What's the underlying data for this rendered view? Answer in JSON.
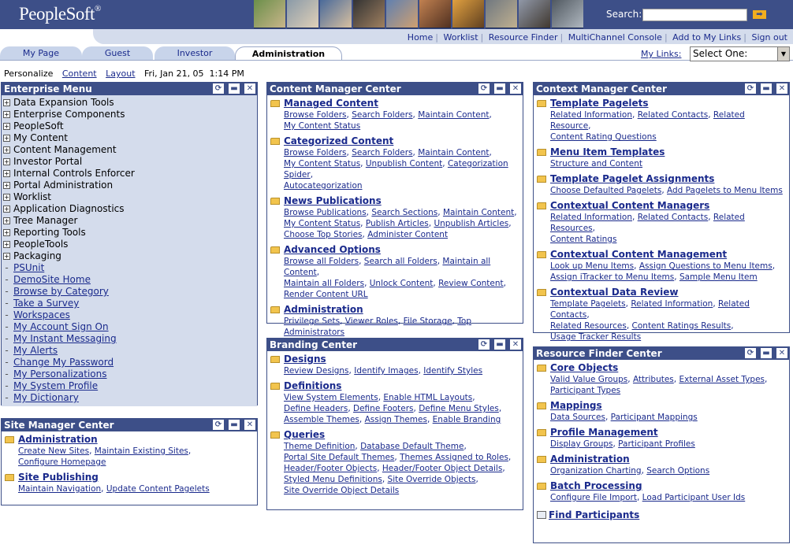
{
  "header": {
    "logo": "PeopleSoft",
    "logo_mark": "®",
    "search_label": "Search:",
    "search_value": "",
    "search_go": "➡"
  },
  "top_links": [
    "Home",
    "Worklist",
    "Resource Finder",
    "MultiChannel Console",
    "Add to My Links",
    "Sign out"
  ],
  "tabs": [
    "My Page",
    "Guest",
    "Investor",
    "Administration"
  ],
  "active_tab": "Administration",
  "my_links": {
    "label": "My Links:",
    "selected": "Select One:"
  },
  "personalize_bar": {
    "personalize": "Personalize",
    "content": "Content",
    "layout": "Layout",
    "datetime": "Fri, Jan 21, 05  1:14 PM"
  },
  "panel_controls": {
    "refresh": "⟳",
    "minimize": "▬",
    "close": "✕"
  },
  "enterprise_menu": {
    "title": "Enterprise Menu",
    "folders": [
      "Data Expansion Tools",
      "Enterprise Components",
      "PeopleSoft",
      "My Content",
      "Content Management",
      "Investor Portal",
      "Internal Controls Enforcer",
      "Portal Administration",
      "Worklist",
      "Application Diagnostics",
      "Tree Manager",
      "Reporting Tools",
      "PeopleTools",
      "Packaging"
    ],
    "links": [
      "PSUnit",
      "DemoSite Home",
      "Browse by Category",
      "Take a Survey",
      "Workspaces",
      "My Account Sign On",
      "My Instant Messaging",
      "My Alerts",
      "Change My Password",
      "My Personalizations",
      "My System Profile",
      "My Dictionary"
    ]
  },
  "site_manager": {
    "title": "Site Manager Center",
    "sections": [
      {
        "title": "Administration",
        "lines": [
          [
            "Create New Sites",
            "Maintain Existing Sites"
          ],
          [
            "Configure Homepage"
          ]
        ]
      },
      {
        "title": "Site Publishing",
        "lines": [
          [
            "Maintain Navigation",
            "Update Content Pagelets"
          ]
        ]
      }
    ]
  },
  "content_manager": {
    "title": "Content Manager Center",
    "sections": [
      {
        "title": "Managed Content",
        "lines": [
          [
            "Browse Folders",
            "Search Folders",
            "Maintain Content"
          ],
          [
            "My Content Status"
          ]
        ]
      },
      {
        "title": "Categorized Content",
        "lines": [
          [
            "Browse Folders",
            "Search Folders",
            "Maintain Content"
          ],
          [
            "My Content Status",
            "Unpublish Content",
            "Categorization Spider"
          ],
          [
            "Autocategorization"
          ]
        ]
      },
      {
        "title": "News Publications",
        "lines": [
          [
            "Browse Publications",
            "Search Sections",
            "Maintain Content"
          ],
          [
            "My Content Status",
            "Publish Articles",
            "Unpublish Articles"
          ],
          [
            "Choose Top Stories",
            "Administer Content"
          ]
        ]
      },
      {
        "title": "Advanced Options",
        "lines": [
          [
            "Browse all Folders",
            "Search all Folders",
            "Maintain all Content"
          ],
          [
            "Maintain all Folders",
            "Unlock Content",
            "Review Content"
          ],
          [
            "Render Content URL"
          ]
        ]
      },
      {
        "title": "Administration",
        "lines": [
          [
            "Privilege Sets",
            "Viewer Roles",
            "File Storage",
            "Top Administrators"
          ]
        ]
      }
    ]
  },
  "branding": {
    "title": "Branding Center",
    "sections": [
      {
        "title": "Designs",
        "lines": [
          [
            "Review Designs",
            "Identify Images",
            "Identify Styles"
          ]
        ]
      },
      {
        "title": "Definitions",
        "lines": [
          [
            "View System Elements",
            "Enable HTML Layouts"
          ],
          [
            "Define Headers",
            "Define Footers",
            "Define Menu Styles"
          ],
          [
            "Assemble Themes",
            "Assign Themes",
            "Enable Branding"
          ]
        ]
      },
      {
        "title": "Queries",
        "lines": [
          [
            "Theme Definition",
            "Database Default Theme"
          ],
          [
            "Portal Site Default Themes",
            "Themes Assigned to Roles"
          ],
          [
            "Header/Footer Objects",
            "Header/Footer Object Details"
          ],
          [
            "Styled Menu Definitions",
            "Site Override Objects"
          ],
          [
            "Site Override Object Details"
          ]
        ]
      }
    ]
  },
  "context_manager": {
    "title": "Context Manager Center",
    "sections": [
      {
        "title": "Template Pagelets",
        "lines": [
          [
            "Related Information",
            "Related Contacts",
            "Related Resource"
          ],
          [
            "Content Rating Questions"
          ]
        ]
      },
      {
        "title": "Menu Item Templates",
        "lines": [
          [
            "Structure and Content"
          ]
        ]
      },
      {
        "title": "Template Pagelet Assignments",
        "lines": [
          [
            "Choose Defaulted Pagelets",
            "Add Pagelets to Menu Items"
          ]
        ]
      },
      {
        "title": "Contextual Content Managers",
        "lines": [
          [
            "Related Information",
            "Related Contacts",
            "Related Resources"
          ],
          [
            "Content Ratings"
          ]
        ]
      },
      {
        "title": "Contextual Content Management",
        "lines": [
          [
            "Look up Menu Items",
            "Assign Questions to Menu Items"
          ],
          [
            "Assign iTracker to Menu Items",
            "Sample Menu Item"
          ]
        ]
      },
      {
        "title": "Contextual Data Review",
        "lines": [
          [
            "Template Pagelets",
            "Related Information",
            "Related Contacts"
          ],
          [
            "Related Resources",
            "Content Ratings Results"
          ],
          [
            "Usage Tracker Results"
          ]
        ]
      }
    ]
  },
  "resource_finder": {
    "title": "Resource Finder Center",
    "sections": [
      {
        "title": "Core Objects",
        "lines": [
          [
            "Valid Value Groups",
            "Attributes",
            "External Asset Types"
          ],
          [
            "Participant Types"
          ]
        ]
      },
      {
        "title": "Mappings",
        "lines": [
          [
            "Data Sources",
            "Participant Mappings"
          ]
        ]
      },
      {
        "title": "Profile Management",
        "lines": [
          [
            "Display Groups",
            "Participant Profiles"
          ]
        ]
      },
      {
        "title": "Administration",
        "lines": [
          [
            "Organization Charting",
            "Search Options"
          ]
        ]
      },
      {
        "title": "Batch Processing",
        "lines": [
          [
            "Configure File Import",
            "Load Participant User Ids"
          ]
        ]
      }
    ],
    "find_participants": "Find Participants"
  }
}
